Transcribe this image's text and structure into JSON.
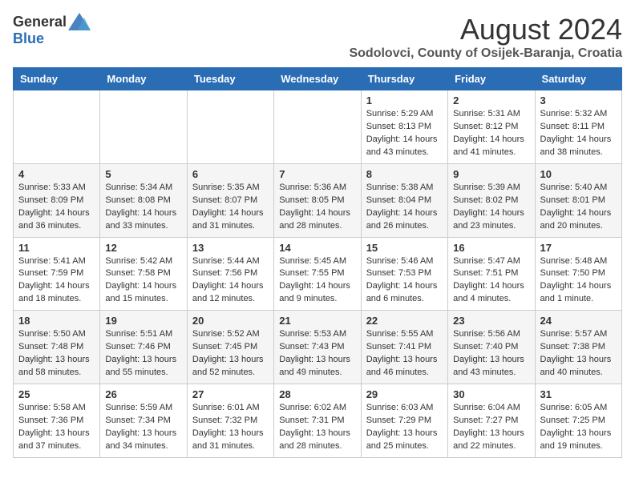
{
  "logo": {
    "general": "General",
    "blue": "Blue"
  },
  "title": {
    "month": "August 2024",
    "location": "Sodolovci, County of Osijek-Baranja, Croatia"
  },
  "days_of_week": [
    "Sunday",
    "Monday",
    "Tuesday",
    "Wednesday",
    "Thursday",
    "Friday",
    "Saturday"
  ],
  "weeks": [
    [
      {
        "day": "",
        "info": ""
      },
      {
        "day": "",
        "info": ""
      },
      {
        "day": "",
        "info": ""
      },
      {
        "day": "",
        "info": ""
      },
      {
        "day": "1",
        "info": "Sunrise: 5:29 AM\nSunset: 8:13 PM\nDaylight: 14 hours\nand 43 minutes."
      },
      {
        "day": "2",
        "info": "Sunrise: 5:31 AM\nSunset: 8:12 PM\nDaylight: 14 hours\nand 41 minutes."
      },
      {
        "day": "3",
        "info": "Sunrise: 5:32 AM\nSunset: 8:11 PM\nDaylight: 14 hours\nand 38 minutes."
      }
    ],
    [
      {
        "day": "4",
        "info": "Sunrise: 5:33 AM\nSunset: 8:09 PM\nDaylight: 14 hours\nand 36 minutes."
      },
      {
        "day": "5",
        "info": "Sunrise: 5:34 AM\nSunset: 8:08 PM\nDaylight: 14 hours\nand 33 minutes."
      },
      {
        "day": "6",
        "info": "Sunrise: 5:35 AM\nSunset: 8:07 PM\nDaylight: 14 hours\nand 31 minutes."
      },
      {
        "day": "7",
        "info": "Sunrise: 5:36 AM\nSunset: 8:05 PM\nDaylight: 14 hours\nand 28 minutes."
      },
      {
        "day": "8",
        "info": "Sunrise: 5:38 AM\nSunset: 8:04 PM\nDaylight: 14 hours\nand 26 minutes."
      },
      {
        "day": "9",
        "info": "Sunrise: 5:39 AM\nSunset: 8:02 PM\nDaylight: 14 hours\nand 23 minutes."
      },
      {
        "day": "10",
        "info": "Sunrise: 5:40 AM\nSunset: 8:01 PM\nDaylight: 14 hours\nand 20 minutes."
      }
    ],
    [
      {
        "day": "11",
        "info": "Sunrise: 5:41 AM\nSunset: 7:59 PM\nDaylight: 14 hours\nand 18 minutes."
      },
      {
        "day": "12",
        "info": "Sunrise: 5:42 AM\nSunset: 7:58 PM\nDaylight: 14 hours\nand 15 minutes."
      },
      {
        "day": "13",
        "info": "Sunrise: 5:44 AM\nSunset: 7:56 PM\nDaylight: 14 hours\nand 12 minutes."
      },
      {
        "day": "14",
        "info": "Sunrise: 5:45 AM\nSunset: 7:55 PM\nDaylight: 14 hours\nand 9 minutes."
      },
      {
        "day": "15",
        "info": "Sunrise: 5:46 AM\nSunset: 7:53 PM\nDaylight: 14 hours\nand 6 minutes."
      },
      {
        "day": "16",
        "info": "Sunrise: 5:47 AM\nSunset: 7:51 PM\nDaylight: 14 hours\nand 4 minutes."
      },
      {
        "day": "17",
        "info": "Sunrise: 5:48 AM\nSunset: 7:50 PM\nDaylight: 14 hours\nand 1 minute."
      }
    ],
    [
      {
        "day": "18",
        "info": "Sunrise: 5:50 AM\nSunset: 7:48 PM\nDaylight: 13 hours\nand 58 minutes."
      },
      {
        "day": "19",
        "info": "Sunrise: 5:51 AM\nSunset: 7:46 PM\nDaylight: 13 hours\nand 55 minutes."
      },
      {
        "day": "20",
        "info": "Sunrise: 5:52 AM\nSunset: 7:45 PM\nDaylight: 13 hours\nand 52 minutes."
      },
      {
        "day": "21",
        "info": "Sunrise: 5:53 AM\nSunset: 7:43 PM\nDaylight: 13 hours\nand 49 minutes."
      },
      {
        "day": "22",
        "info": "Sunrise: 5:55 AM\nSunset: 7:41 PM\nDaylight: 13 hours\nand 46 minutes."
      },
      {
        "day": "23",
        "info": "Sunrise: 5:56 AM\nSunset: 7:40 PM\nDaylight: 13 hours\nand 43 minutes."
      },
      {
        "day": "24",
        "info": "Sunrise: 5:57 AM\nSunset: 7:38 PM\nDaylight: 13 hours\nand 40 minutes."
      }
    ],
    [
      {
        "day": "25",
        "info": "Sunrise: 5:58 AM\nSunset: 7:36 PM\nDaylight: 13 hours\nand 37 minutes."
      },
      {
        "day": "26",
        "info": "Sunrise: 5:59 AM\nSunset: 7:34 PM\nDaylight: 13 hours\nand 34 minutes."
      },
      {
        "day": "27",
        "info": "Sunrise: 6:01 AM\nSunset: 7:32 PM\nDaylight: 13 hours\nand 31 minutes."
      },
      {
        "day": "28",
        "info": "Sunrise: 6:02 AM\nSunset: 7:31 PM\nDaylight: 13 hours\nand 28 minutes."
      },
      {
        "day": "29",
        "info": "Sunrise: 6:03 AM\nSunset: 7:29 PM\nDaylight: 13 hours\nand 25 minutes."
      },
      {
        "day": "30",
        "info": "Sunrise: 6:04 AM\nSunset: 7:27 PM\nDaylight: 13 hours\nand 22 minutes."
      },
      {
        "day": "31",
        "info": "Sunrise: 6:05 AM\nSunset: 7:25 PM\nDaylight: 13 hours\nand 19 minutes."
      }
    ]
  ]
}
